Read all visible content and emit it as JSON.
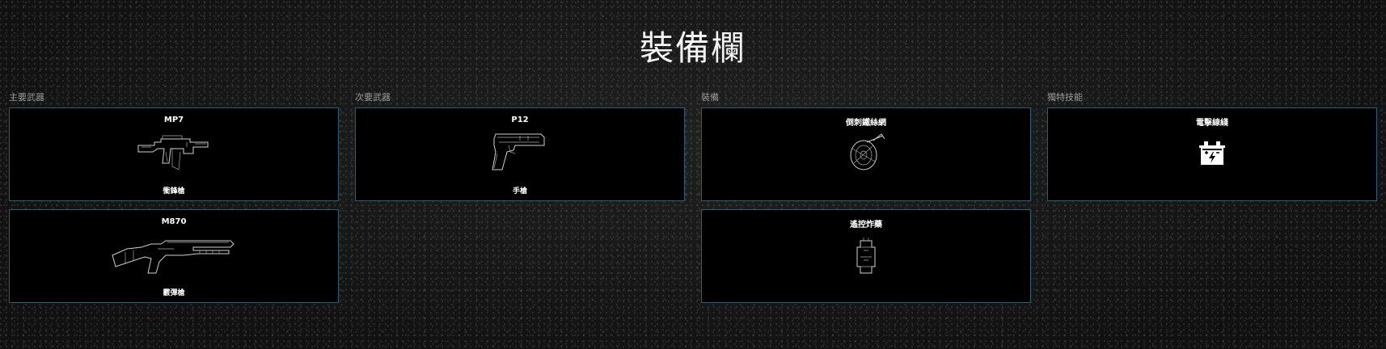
{
  "page": {
    "title": "裝備欄"
  },
  "columns": [
    {
      "label": "主要武器",
      "items": [
        {
          "name": "MP7",
          "type": "衝鋒槍",
          "icon": "submachine-gun-icon"
        },
        {
          "name": "M870",
          "type": "霰彈槍",
          "icon": "shotgun-icon"
        }
      ]
    },
    {
      "label": "次要武器",
      "items": [
        {
          "name": "P12",
          "type": "手槍",
          "icon": "pistol-icon"
        }
      ]
    },
    {
      "label": "裝備",
      "items": [
        {
          "name": "倒刺鐵絲網",
          "icon": "barbed-wire-icon"
        },
        {
          "name": "遙控炸藥",
          "icon": "remote-charge-icon"
        }
      ]
    },
    {
      "label": "獨特技能",
      "items": [
        {
          "name": "電擊線綫",
          "icon": "battery-shock-icon"
        }
      ]
    }
  ],
  "colors": {
    "card_border": "#2a5f78",
    "card_background": "#000000",
    "label_text": "#9a9a9a"
  }
}
